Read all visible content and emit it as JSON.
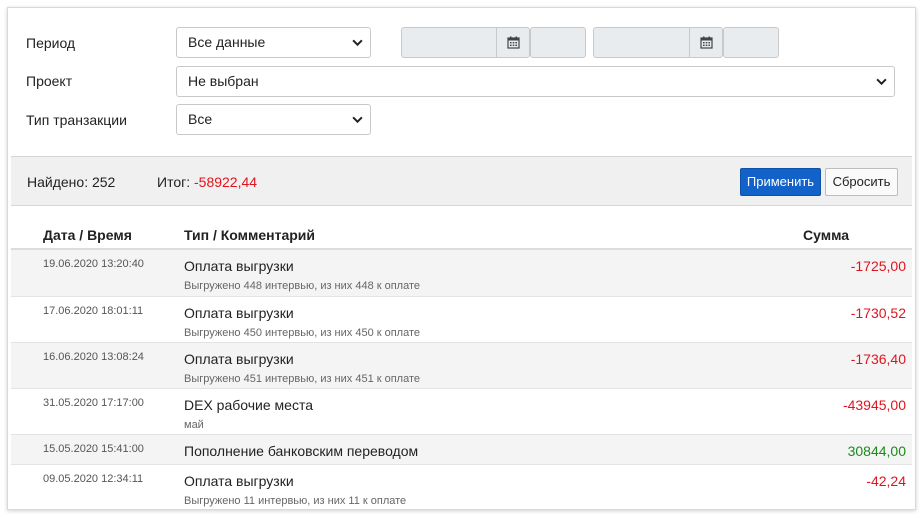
{
  "filters": {
    "period_label": "Период",
    "period_value": "Все данные",
    "project_label": "Проект",
    "project_value": "Не выбран",
    "type_label": "Тип транзакции",
    "type_value": "Все"
  },
  "summary": {
    "found_text": "Найдено: 252",
    "total_label": "Итог: ",
    "total_value": "-58922,44",
    "apply_label": "Применить",
    "reset_label": "Сбросить"
  },
  "table": {
    "headers": {
      "date": "Дата / Время",
      "type": "Тип / Комментарий",
      "amount": "Сумма"
    },
    "rows": [
      {
        "date": "19.06.2020 13:20:40",
        "title": "Оплата выгрузки",
        "comment": "Выгружено 448 интервью, из них 448 к оплате",
        "amount": "-1725,00",
        "sign": "neg"
      },
      {
        "date": "17.06.2020 18:01:11",
        "title": "Оплата выгрузки",
        "comment": "Выгружено 450 интервью, из них 450 к оплате",
        "amount": "-1730,52",
        "sign": "neg"
      },
      {
        "date": "16.06.2020 13:08:24",
        "title": "Оплата выгрузки",
        "comment": "Выгружено 451 интервью, из них 451 к оплате",
        "amount": "-1736,40",
        "sign": "neg"
      },
      {
        "date": "31.05.2020 17:17:00",
        "title": "DEX рабочие места",
        "comment": "май",
        "amount": "-43945,00",
        "sign": "neg"
      },
      {
        "date": "15.05.2020 15:41:00",
        "title": "Пополнение банковским переводом",
        "comment": "",
        "amount": "30844,00",
        "sign": "pos"
      },
      {
        "date": "09.05.2020 12:34:11",
        "title": "Оплата выгрузки",
        "comment": "Выгружено 11 интервью, из них 11 к оплате",
        "amount": "-42,24",
        "sign": "neg"
      }
    ]
  },
  "colors": {
    "negative": "#e0141e",
    "positive": "#1a8a1a",
    "primary_button": "#1262c9"
  },
  "icons": {
    "date_from": "calendar-icon",
    "date_to": "calendar-icon",
    "select": "chevron-down-icon"
  }
}
